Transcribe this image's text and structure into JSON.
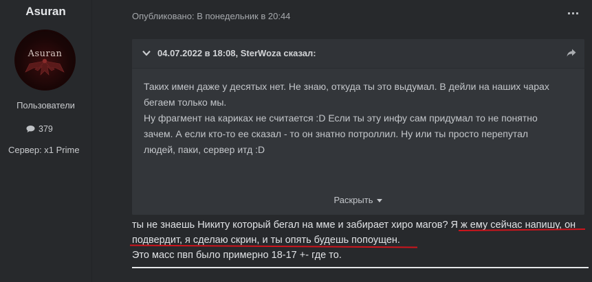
{
  "author": {
    "name": "Asuran",
    "avatar_text": "Asuran",
    "group": "Пользователи",
    "post_count": "379",
    "server": "Сервер: x1 Prime"
  },
  "post": {
    "published": "Опубликовано: В понедельник в 20:44",
    "quote": {
      "citation": "04.07.2022 в 18:08, SterWoza сказал:",
      "lines": [
        "Таких имен даже у десятых нет. Не знаю, откуда ты это выдумал. В дейли на наших чарах",
        "бегаем только мы.",
        "Ну фрагмент на кариках не считается :D Если ты эту инфу сам придумал то не понятно",
        "зачем. А если кто-то ее сказал - то он знатно потроллил. Ну или ты просто перепутал",
        "людей, паки, сервер итд :D"
      ],
      "expand_label": "Раскрыть"
    },
    "reply_lines": [
      "ты не знаешь Никиту который бегал на мме и забирает хиро магов? Я ж ему сейчас напишу, он",
      "подвердит, я сделаю скрин, и ты опять будешь попоущен.",
      "Это масс пвп было примерно 18-17 +- где то."
    ]
  },
  "icons": {
    "posts": "comment-icon",
    "more": "more-options-icon",
    "chevron": "chevron-down-icon",
    "share": "share-icon"
  },
  "colors": {
    "background": "#27292c",
    "quote_background": "#33363a",
    "highlight_underline": "#d0141c"
  }
}
